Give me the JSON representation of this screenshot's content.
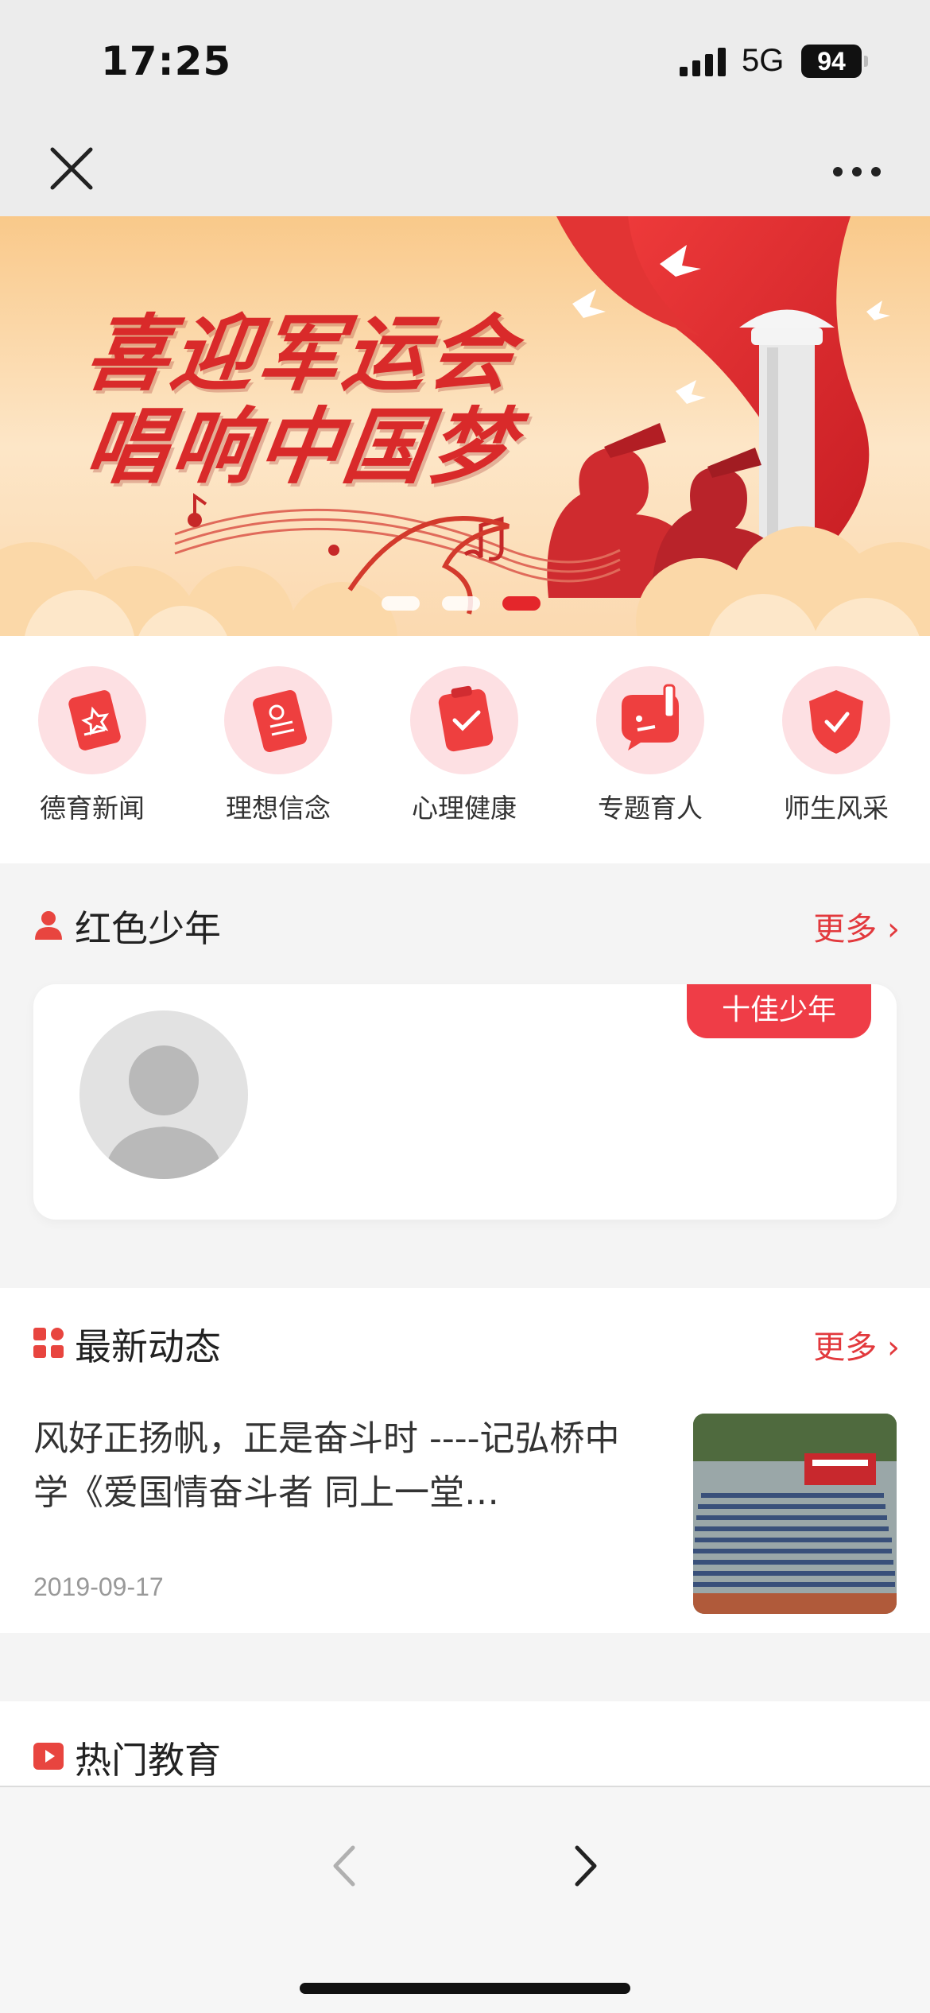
{
  "status_bar": {
    "time": "17:25",
    "network": "5G",
    "battery": "94"
  },
  "banner": {
    "line1": "喜迎军运会",
    "line2": "唱响中国梦",
    "slide_count": 3,
    "active_slide": 3
  },
  "quick_menu": [
    {
      "label": "德育新闻",
      "icon": "news-icon"
    },
    {
      "label": "理想信念",
      "icon": "party-book-icon"
    },
    {
      "label": "心理健康",
      "icon": "clipboard-check-icon"
    },
    {
      "label": "专题育人",
      "icon": "chat-pen-icon"
    },
    {
      "label": "师生风采",
      "icon": "shield-check-icon"
    }
  ],
  "red_youth": {
    "title": "红色少年",
    "more": "更多",
    "badge": "十佳少年"
  },
  "latest_news": {
    "title": "最新动态",
    "more": "更多",
    "item": {
      "title": "风好正扬帆，正是奋斗时 ----记弘桥中学《爱国情奋斗者 同上一堂…",
      "date": "2019-09-17"
    }
  },
  "hot_education": {
    "title": "热门教育"
  },
  "colors": {
    "accent": "#e2393d",
    "icon_bg": "#fde0e3",
    "banner_bg": "#fce1bf"
  }
}
